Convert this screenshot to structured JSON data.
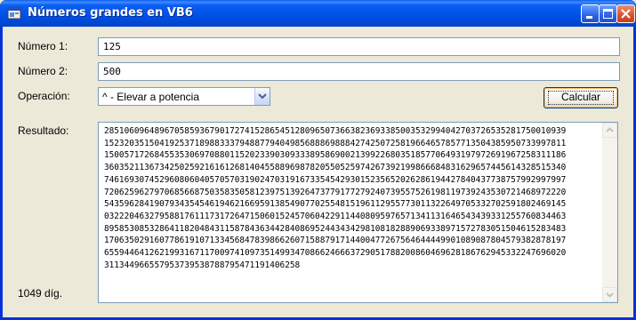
{
  "window": {
    "title": "Números grandes en VB6"
  },
  "form": {
    "num1_label": "Número 1:",
    "num1_value": "125",
    "num2_label": "Número 2:",
    "num2_value": "500",
    "op_label": "Operación:",
    "op_selected": "^ - Elevar a potencia",
    "calc_label": "Calcular",
    "result_label": "Resultado:",
    "digits_text": "1049 díg."
  },
  "result": {
    "text": "2851060964896705859367901727415286545128096507366382369338500353299404270372653528175001093915232035150419253718988333794887794049856888698884274250725819664657857713504385950733997811150057172684553530697088011520233903093338958690021399226803518577064931979726919672583111863603521136734250259216161268140455889698782055052597426739219986668483162965744561432851534074616930745296080604057057031902470319167335454293015235652026286194427840437738757992997997720625962797068566875035835058123975139264737791772792407395575261981197392435307214689722205435962841907934354546194621669591385490770255481519611295577301132264970533270259180246914503222046327958817611173172647150601524570604229114408095976571341131646543439331255760834463895853085328641182048431158784363442840869524434342981081828890693389715727830515046152834831706350291607786191071334568478398662607158879171440047726756464444990108908780457938287819765594464126219931671170097410973514993470866246663729051788200860469628186762945332247696020311344966557953739538788795471191406258",
    "line_length": 92
  },
  "icons": [
    "vb6-app-icon",
    "minimize-icon",
    "maximize-icon",
    "close-icon",
    "chevron-down-icon",
    "scroll-up-icon",
    "scroll-down-icon"
  ]
}
